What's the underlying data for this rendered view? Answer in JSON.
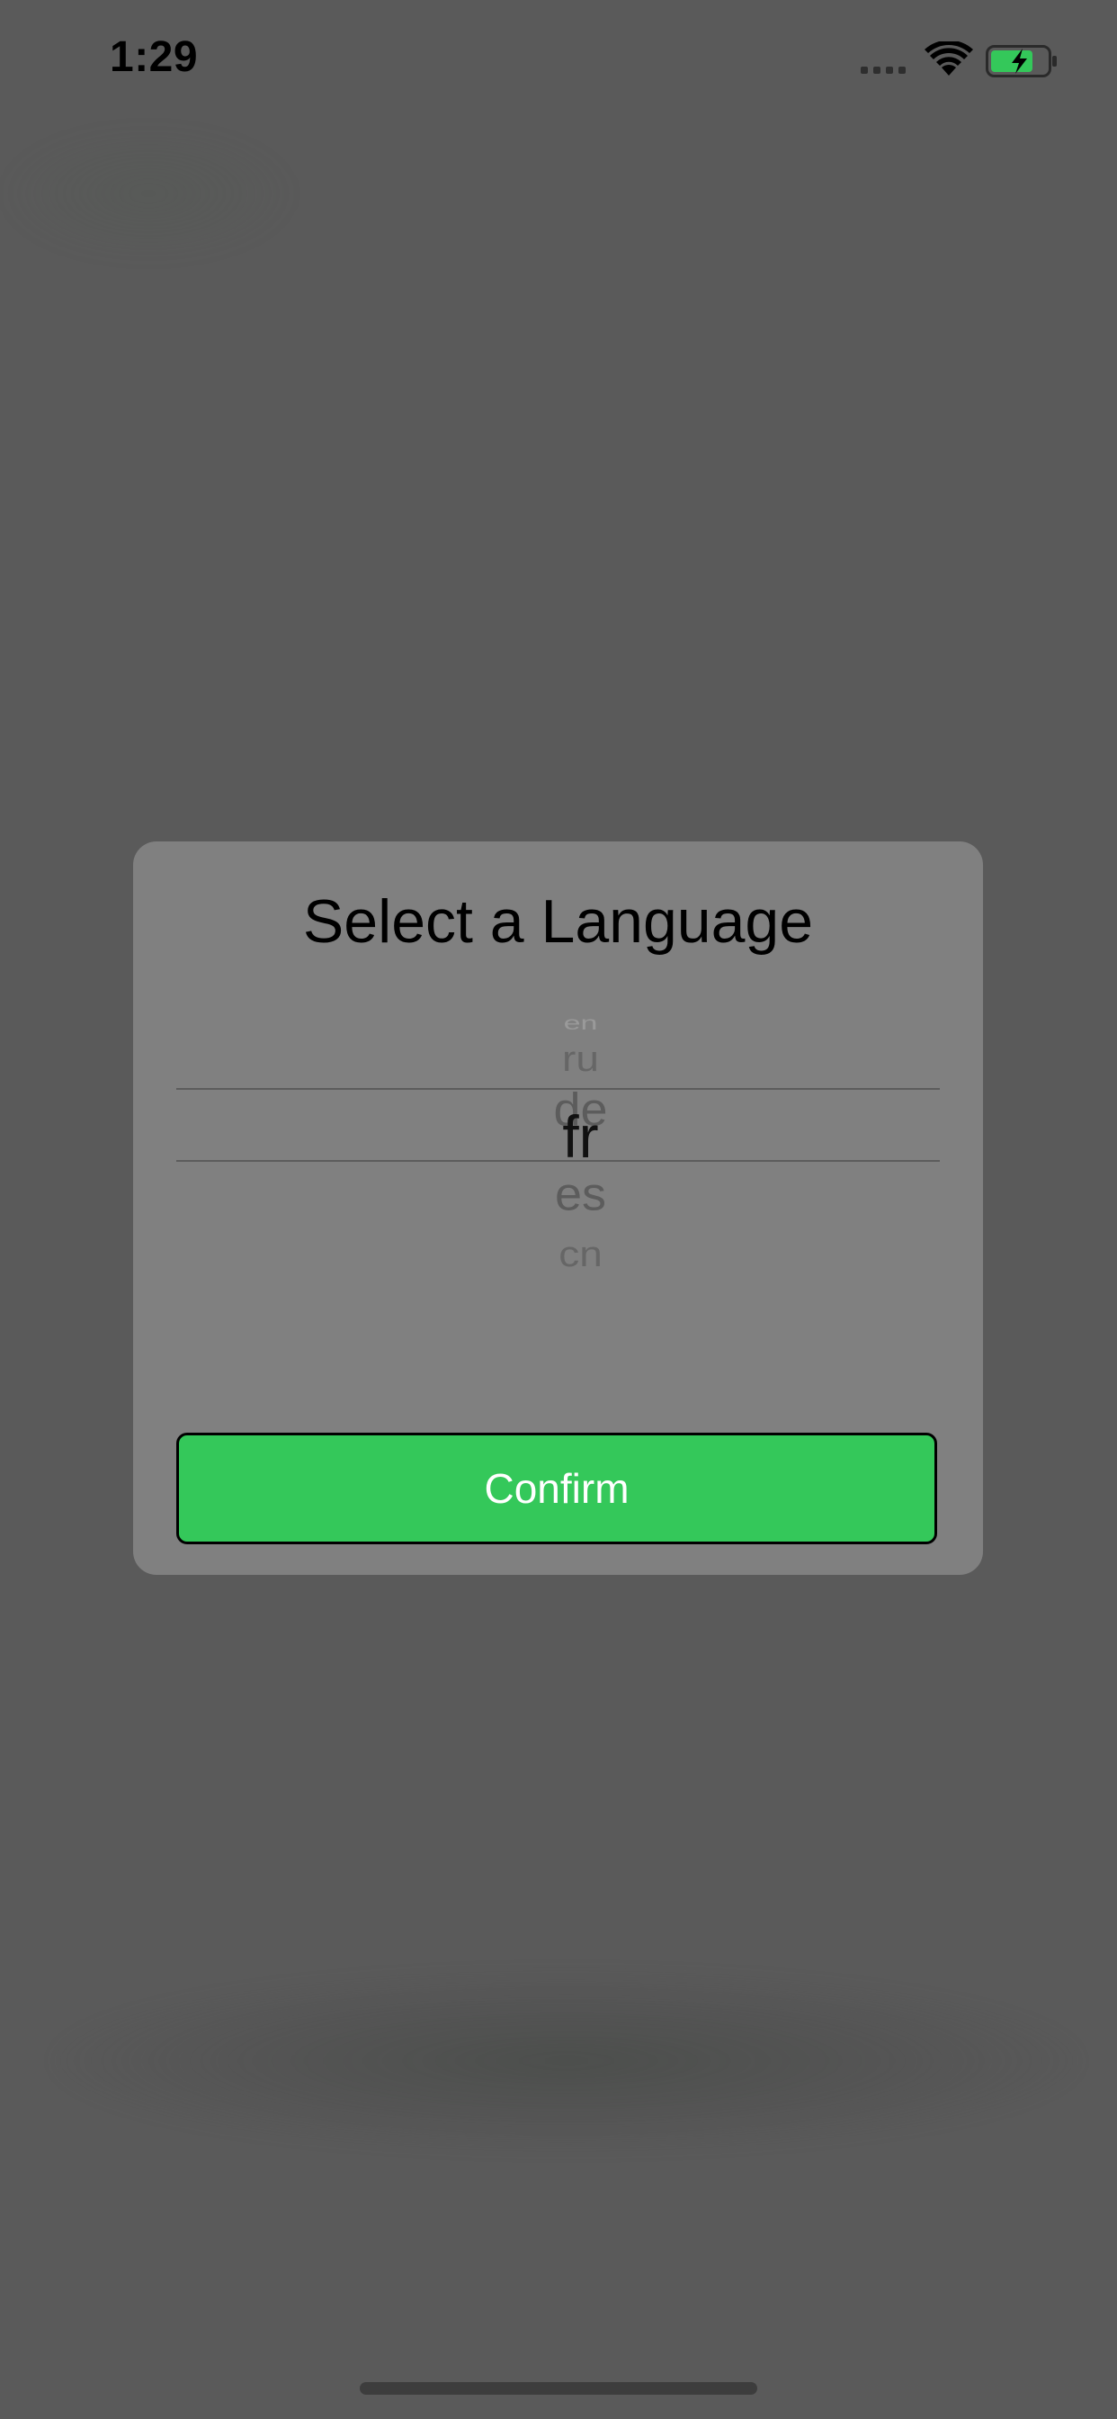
{
  "status_bar": {
    "time": "1:29",
    "icons": [
      "signal-icon",
      "wifi-icon",
      "battery-charging-icon"
    ],
    "battery_color": "#34c85a"
  },
  "dialog": {
    "title": "Select a Language",
    "picker": {
      "items": [
        "en",
        "ru",
        "de",
        "fr",
        "es",
        "cn"
      ],
      "selected": "fr"
    },
    "confirm_label": "Confirm",
    "confirm_color": "#34c85a"
  },
  "colors": {
    "backdrop": "#5a5a5a",
    "dialog_background": "#808080"
  }
}
